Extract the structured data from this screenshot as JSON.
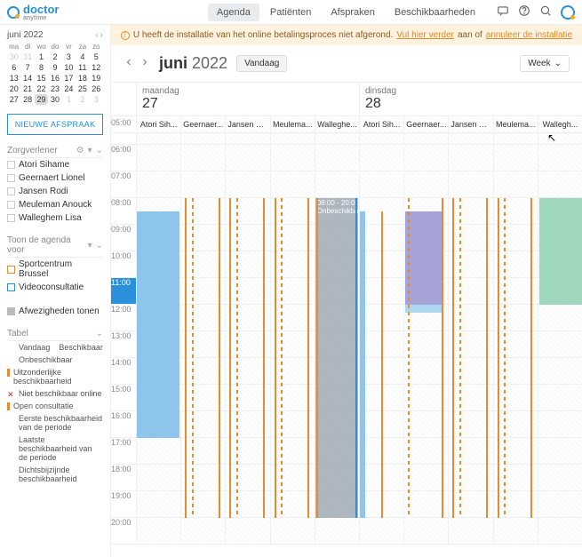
{
  "brand": {
    "name": "doctor",
    "sub": "anytime"
  },
  "nav": {
    "agenda": "Agenda",
    "patients": "Patiënten",
    "appointments": "Afspraken",
    "availabilities": "Beschikbaarheden"
  },
  "banner": {
    "text": "U heeft de installatie van het online betalingsproces niet afgerond.",
    "link1": "Vul hier verder",
    "sep": "aan of",
    "link2": "annuleer de installatie"
  },
  "header": {
    "month": "juni",
    "year": "2022",
    "today": "Vandaag",
    "view": "Week"
  },
  "days": [
    {
      "dow": "maandag",
      "num": "27"
    },
    {
      "dow": "dinsdag",
      "num": "28"
    }
  ],
  "resources": [
    "Atori Sih...",
    "Geernaer...",
    "Jansen R...",
    "Meulema...",
    "Walleghe...",
    "Atori Sih...",
    "Geernaer...",
    "Jansen R...",
    "Meulema...",
    "Wallegh..."
  ],
  "hours": [
    "05:00",
    "06:00",
    "07:00",
    "08:00",
    "09:00",
    "10:00",
    "11:00",
    "12:00",
    "13:00",
    "14:00",
    "15:00",
    "16:00",
    "17:00",
    "18:00",
    "19:00",
    "20:00"
  ],
  "tooltip": {
    "time": "08:00 - 20:00",
    "label": "Onbeschikba..."
  },
  "mini": {
    "title": "juni 2022",
    "dow": [
      "ma",
      "di",
      "wo",
      "do",
      "vr",
      "za",
      "zo"
    ],
    "weeks": [
      [
        "30",
        "31",
        "1",
        "2",
        "3",
        "4",
        "5"
      ],
      [
        "6",
        "7",
        "8",
        "9",
        "10",
        "11",
        "12"
      ],
      [
        "13",
        "14",
        "15",
        "16",
        "17",
        "18",
        "19"
      ],
      [
        "20",
        "21",
        "22",
        "23",
        "24",
        "25",
        "26"
      ],
      [
        "27",
        "28",
        "29",
        "30",
        "1",
        "2",
        "3"
      ]
    ]
  },
  "sidebar": {
    "new": "NIEUWE AFSPRAAK",
    "providers_title": "Zorgverlener",
    "providers": [
      "Atori Sihame",
      "Geernaert Lionel",
      "Jansen Rodi",
      "Meuleman Anouck",
      "Walleghem Lisa"
    ],
    "show_for": "Toon de agenda voor",
    "loc1": "Sportcentrum Brussel",
    "loc2": "Videoconsultatie",
    "absences": "Afwezigheden tonen",
    "table_title": "Tabel",
    "legend": {
      "today": "Vandaag",
      "available": "Beschikbaar",
      "unavailable": "Onbeschikbaar",
      "exceptional": "Uitzonderlijke beschikbaarheid",
      "not_online": "Niet beschikbaar online",
      "open": "Open consultatie",
      "first": "Eerste beschikbaarheid van de periode",
      "last": "Laatste beschikbaarheid van de periode",
      "nearest": "Dichtsbijzijnde beschikbaarheid"
    }
  }
}
